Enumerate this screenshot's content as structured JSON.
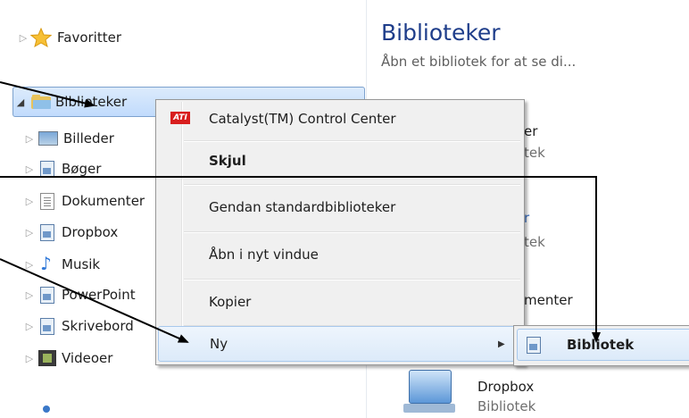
{
  "nav": {
    "favorites": "Favoritter",
    "libraries": "Biblioteker",
    "items": [
      {
        "label": "Billeder",
        "icon": "pictures-icon"
      },
      {
        "label": "Bøger",
        "icon": "library-icon"
      },
      {
        "label": "Dokumenter",
        "icon": "documents-icon"
      },
      {
        "label": "Dropbox",
        "icon": "library-icon"
      },
      {
        "label": "Musik",
        "icon": "music-icon"
      },
      {
        "label": "PowerPoint",
        "icon": "library-icon"
      },
      {
        "label": "Skrivebord",
        "icon": "library-icon"
      },
      {
        "label": "Videoer",
        "icon": "video-icon"
      }
    ]
  },
  "content": {
    "title": "Biblioteker",
    "subtitle": "Åbn et bibliotek for at se di...",
    "frag1": "er",
    "frag2": "tek",
    "frag3": "r",
    "frag4": "tek",
    "frag5": "menter",
    "frag6": "Dropbox",
    "frag7": "Bibliotek"
  },
  "context_menu": {
    "items": [
      {
        "label": "Catalyst(TM) Control Center",
        "icon": "ati-icon"
      },
      {
        "label": "Skjul",
        "bold": true
      },
      {
        "label": "Gendan standardbiblioteker"
      },
      {
        "label": "Åbn i nyt vindue"
      },
      {
        "label": "Kopier"
      },
      {
        "label": "Ny",
        "submenu": true
      }
    ],
    "ati_badge": "ATI"
  },
  "submenu": {
    "item": "Bibliotek"
  }
}
